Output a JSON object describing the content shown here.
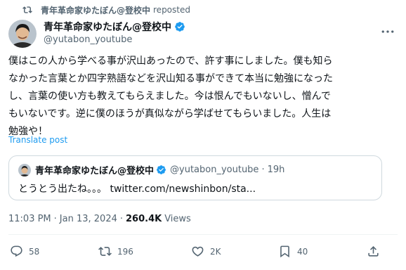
{
  "repost": {
    "user": "青年革命家ゆたぼん@登校中",
    "suffix": "reposted"
  },
  "author": {
    "name": "青年革命家ゆたぼん@登校中",
    "handle": "@yutabon_youtube"
  },
  "tweet": {
    "text": "僕はこの人から学べる事が沢山あったので、許す事にしました。僕も知ら\nなかった言葉とか四字熟語などを沢山知る事ができて本当に勉強になった\nし、言葉の使い方も教えてもらえました。今は恨んでもいないし、憎んで\nもいないです。逆に僕のほうが真似ながら学ばせてもらいました。人生は\n勉強や！",
    "translate_label": "Translate post"
  },
  "quote": {
    "name": "青年革命家ゆたぼん@登校中",
    "handle": "@yutabon_youtube",
    "separator": "·",
    "time": "19h",
    "text": "とうとう出たね。。。 twitter.com/newshinbon/sta..."
  },
  "meta": {
    "time": "11:03 PM",
    "dot1": "·",
    "date": "Jan 13, 2024",
    "dot2": "·",
    "views_count": "260.4K",
    "views_label": "Views"
  },
  "actions": {
    "replies": "58",
    "reposts": "196",
    "likes": "2K",
    "bookmarks": "40"
  },
  "colors": {
    "accent": "#1d9bf0",
    "secondary_text": "#536471",
    "border": "#cfd9de"
  }
}
